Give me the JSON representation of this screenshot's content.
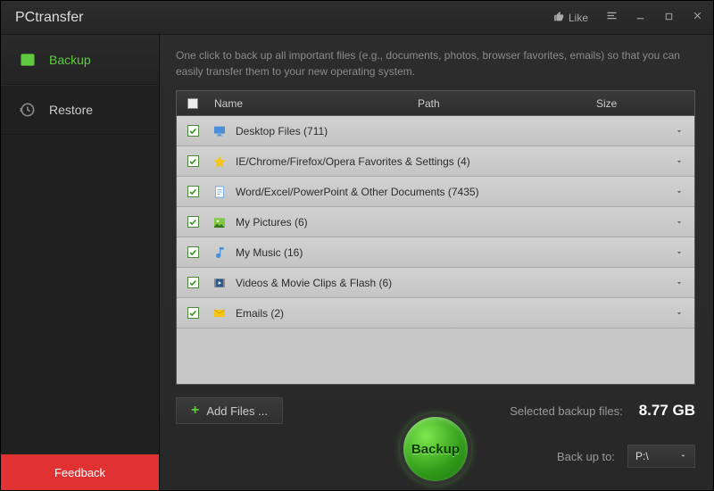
{
  "app": {
    "title": "PCtransfer",
    "like_label": "Like"
  },
  "sidebar": {
    "items": [
      {
        "label": "Backup",
        "active": true
      },
      {
        "label": "Restore",
        "active": false
      }
    ],
    "feedback_label": "Feedback"
  },
  "main": {
    "description": "One click to back up all important files (e.g., documents, photos, browser favorites, emails) so that you can easily transfer them to your new operating system.",
    "columns": {
      "name": "Name",
      "path": "Path",
      "size": "Size"
    },
    "rows": [
      {
        "label": "Desktop Files (711)",
        "icon": "desktop"
      },
      {
        "label": "IE/Chrome/Firefox/Opera Favorites & Settings (4)",
        "icon": "star"
      },
      {
        "label": "Word/Excel/PowerPoint & Other Documents (7435)",
        "icon": "doc"
      },
      {
        "label": "My Pictures (6)",
        "icon": "pictures"
      },
      {
        "label": "My Music (16)",
        "icon": "music"
      },
      {
        "label": "Videos & Movie Clips & Flash (6)",
        "icon": "video"
      },
      {
        "label": "Emails (2)",
        "icon": "mail"
      }
    ],
    "add_files_label": "Add Files ...",
    "selected_label": "Selected backup files:",
    "selected_size": "8.77 GB",
    "backup_to_label": "Back up to:",
    "drive": "P:\\",
    "backup_button": "Backup"
  }
}
